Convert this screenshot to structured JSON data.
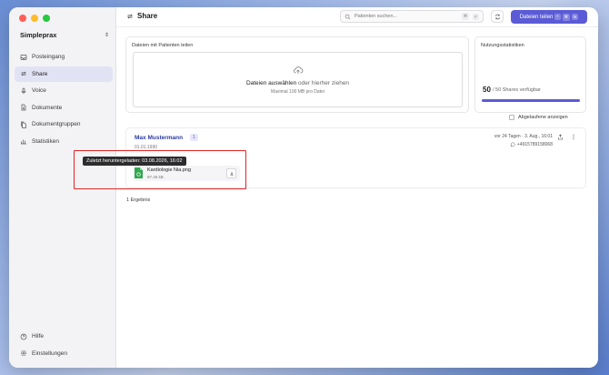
{
  "window": {
    "traffic_colors": [
      "#ff5f57",
      "#febc2e",
      "#28c840"
    ]
  },
  "sidebar": {
    "org_name": "Simpleprax",
    "items": [
      {
        "label": "Posteingang",
        "icon": "inbox-icon",
        "active": false
      },
      {
        "label": "Share",
        "icon": "share-arrows-icon",
        "active": true
      },
      {
        "label": "Voice",
        "icon": "microphone-icon",
        "active": false
      },
      {
        "label": "Dokumente",
        "icon": "document-icon",
        "active": false
      },
      {
        "label": "Dokumentgruppen",
        "icon": "documents-group-icon",
        "active": false
      },
      {
        "label": "Statistiken",
        "icon": "bar-chart-icon",
        "active": false
      }
    ],
    "bottom_items": [
      {
        "label": "Hilfe",
        "icon": "help-icon"
      },
      {
        "label": "Einstellungen",
        "icon": "gear-icon"
      }
    ]
  },
  "header": {
    "title": "Share",
    "search_placeholder": "Patienten suchen...",
    "search_shortcut": [
      "⌘",
      "F"
    ],
    "primary_button": "Dateien teilen",
    "primary_shortcut": [
      "^",
      "⌘",
      "N"
    ]
  },
  "upload": {
    "label": "Dateien mit Patienten teilen",
    "cta_strong": "Dateien auswählen",
    "cta_rest": " oder hierher ziehen",
    "limit": "Maximal 100 MB pro Datei"
  },
  "stats": {
    "label": "Nutzungsstatistiken",
    "used": "50",
    "rest": "/ 50 Shares verfügbar",
    "fill_fraction": 1.0
  },
  "filter": {
    "show_expired": "Abgelaufene anzeigen"
  },
  "patient": {
    "name": "Max Mustermann",
    "count": "1",
    "dob": "01.01.1990",
    "meta": "vor 24 Tagen · 3. Aug., 16:01",
    "phone": "+4915789158068",
    "file": {
      "name": "Kardiologie Nia.png",
      "size": "97.46 kB"
    },
    "tooltip": "Zuletzt heruntergeladen: 03.08.2026, 16:02"
  },
  "results": "1 Ergebnis",
  "colors": {
    "accent": "#5b5bd6",
    "highlight": "#e02424",
    "file_green": "#2fa84f"
  }
}
